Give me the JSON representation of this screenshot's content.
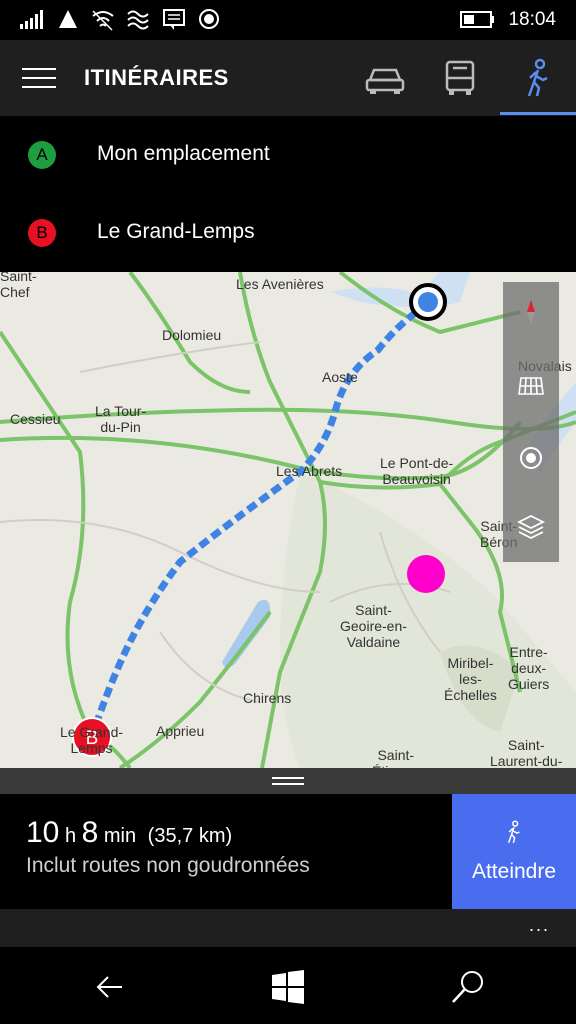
{
  "status": {
    "time": "18:04",
    "icons": [
      "signal-icon",
      "wifi-warning-icon",
      "wifi-icon",
      "vibrate-icon",
      "message-icon",
      "location-icon",
      "battery-icon"
    ]
  },
  "header": {
    "title": "ITINÉRAIRES",
    "modes": [
      "car-icon",
      "bus-icon",
      "walk-icon"
    ],
    "selected_mode": "walk-icon",
    "accent": "#5b8def"
  },
  "route_points": [
    {
      "marker": "A",
      "label": "Mon emplacement",
      "color": "#1e9e3f"
    },
    {
      "marker": "B",
      "label": "Le Grand-Lemps",
      "color": "#e81123"
    }
  ],
  "map": {
    "places": [
      {
        "name": "Saint-\nChef"
      },
      {
        "name": "Les Avenières"
      },
      {
        "name": "Dolomieu"
      },
      {
        "name": "Novalais"
      },
      {
        "name": "Aoste"
      },
      {
        "name": "Cessieu"
      },
      {
        "name": "La Tour-\ndu-Pin"
      },
      {
        "name": "Les Abrets"
      },
      {
        "name": "Le Pont-de-\nBeauvoisin"
      },
      {
        "name": "Saint-\nBéron"
      },
      {
        "name": "Saint-\nGeoire-en-\nValdaine"
      },
      {
        "name": "Miribel-\nles-\nÉchelles"
      },
      {
        "name": "Entre-\ndeux-\nGuiers"
      },
      {
        "name": "Chirens"
      },
      {
        "name": "Apprieu"
      },
      {
        "name": "Le Grand-\nLemps"
      },
      {
        "name": "Saint-\nÉtienne"
      },
      {
        "name": "Saint-\nLaurent-du-"
      }
    ],
    "controls": [
      "compass-icon",
      "grid-icon",
      "locate-icon",
      "layers-icon"
    ],
    "destination_marker": "B",
    "route_color": "#3f84e5",
    "poi_color": "#ff00cc"
  },
  "summary": {
    "hours": "10",
    "h_unit": "h",
    "minutes": "8",
    "min_unit": "min",
    "distance": "(35,7 km)",
    "note": "Inclut routes non goudronnées",
    "go_label": "Atteindre",
    "go_color": "#4a6df0"
  },
  "more": "...",
  "nav": [
    "back-icon",
    "windows-icon",
    "search-icon"
  ]
}
